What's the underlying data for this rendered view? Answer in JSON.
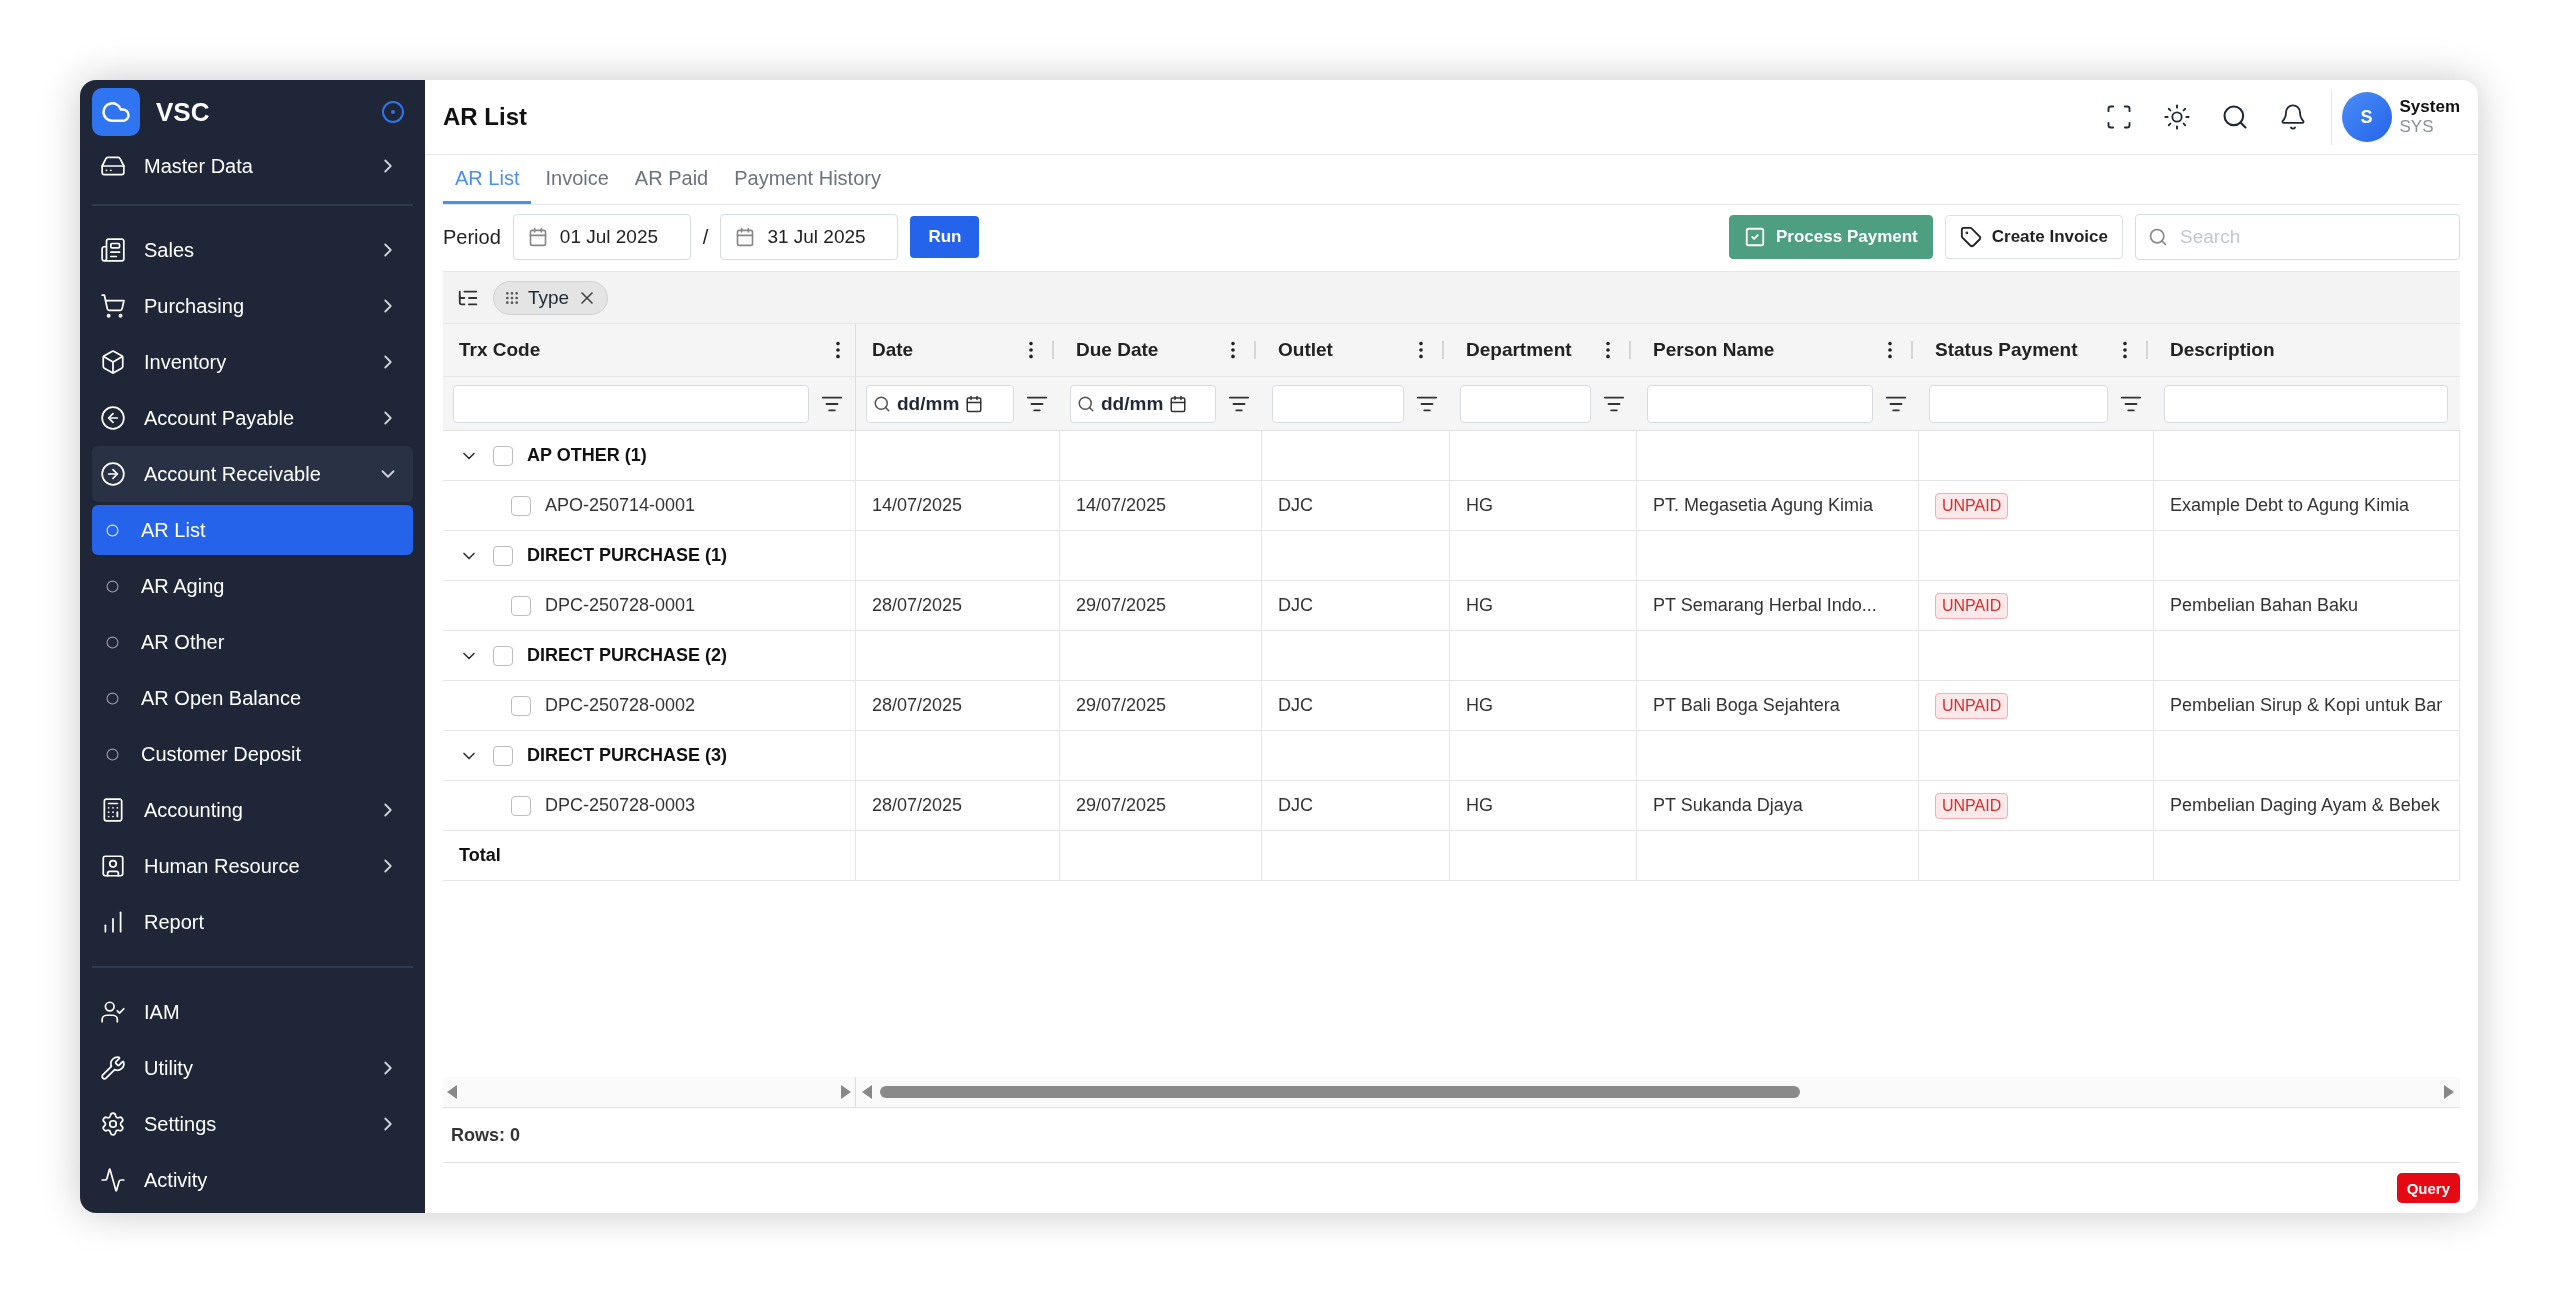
{
  "sidebar": {
    "brand": "VSC",
    "groups": [
      {
        "items": [
          {
            "label": "Master Data",
            "submenu": true,
            "expanded": false
          }
        ]
      },
      {
        "items": [
          {
            "label": "Sales",
            "submenu": true,
            "expanded": false
          },
          {
            "label": "Purchasing",
            "submenu": true,
            "expanded": false
          },
          {
            "label": "Inventory",
            "submenu": true,
            "expanded": false
          },
          {
            "label": "Account Payable",
            "submenu": true,
            "expanded": false
          },
          {
            "label": "Account Receivable",
            "submenu": true,
            "expanded": true,
            "children": [
              {
                "label": "AR List",
                "selected": true
              },
              {
                "label": "AR Aging",
                "selected": false
              },
              {
                "label": "AR Other",
                "selected": false
              },
              {
                "label": "AR Open Balance",
                "selected": false
              },
              {
                "label": "Customer Deposit",
                "selected": false
              }
            ]
          },
          {
            "label": "Accounting",
            "submenu": true,
            "expanded": false
          },
          {
            "label": "Human Resource",
            "submenu": true,
            "expanded": false
          },
          {
            "label": "Report",
            "submenu": false
          }
        ]
      },
      {
        "items": [
          {
            "label": "IAM",
            "submenu": false
          },
          {
            "label": "Utility",
            "submenu": true,
            "expanded": false
          },
          {
            "label": "Settings",
            "submenu": true,
            "expanded": false
          },
          {
            "label": "Activity",
            "submenu": false
          }
        ]
      }
    ]
  },
  "header": {
    "title": "AR List",
    "user": {
      "initial": "S",
      "name": "System",
      "role": "SYS"
    }
  },
  "tabs": [
    {
      "label": "AR List",
      "selected": true
    },
    {
      "label": "Invoice",
      "selected": false
    },
    {
      "label": "AR Paid",
      "selected": false
    },
    {
      "label": "Payment History",
      "selected": false
    }
  ],
  "period": {
    "label": "Period",
    "from": "01 Jul 2025",
    "separator": "/",
    "to": "31 Jul 2025",
    "run": "Run"
  },
  "actions": [
    {
      "label": "Process Payment",
      "kind": "primary"
    },
    {
      "label": "Create Invoice",
      "kind": "outline"
    }
  ],
  "search": {
    "placeholder": "Search"
  },
  "group_by": [
    {
      "label": "Type"
    }
  ],
  "table": {
    "columns": [
      {
        "label": "Trx Code",
        "kind": "text",
        "menu": true
      },
      {
        "label": "Date",
        "kind": "date",
        "filter_value": "dd/mm",
        "menu": true
      },
      {
        "label": "Due Date",
        "kind": "date",
        "filter_value": "dd/mm",
        "menu": true
      },
      {
        "label": "Outlet",
        "kind": "text",
        "menu": true
      },
      {
        "label": "Department",
        "kind": "text",
        "menu": true
      },
      {
        "label": "Person Name",
        "kind": "text",
        "menu": true
      },
      {
        "label": "Status Payment",
        "kind": "status",
        "menu": true
      },
      {
        "label": "Description",
        "kind": "text",
        "menu": false
      }
    ],
    "groups": [
      {
        "label": "AP OTHER (1)",
        "expanded": true,
        "checked": false,
        "rows": [
          {
            "checked": false,
            "cells": [
              "APO-250714-0001",
              "14/07/2025",
              "14/07/2025",
              "DJC",
              "HG",
              "PT. Megasetia Agung Kimia",
              "UNPAID",
              "Example Debt to Agung Kimia"
            ]
          }
        ]
      },
      {
        "label": "DIRECT PURCHASE (1)",
        "expanded": true,
        "checked": false,
        "rows": [
          {
            "checked": false,
            "cells": [
              "DPC-250728-0001",
              "28/07/2025",
              "29/07/2025",
              "DJC",
              "HG",
              "PT Semarang Herbal Indo...",
              "UNPAID",
              "Pembelian Bahan Baku"
            ]
          }
        ]
      },
      {
        "label": "DIRECT PURCHASE (2)",
        "expanded": true,
        "checked": false,
        "rows": [
          {
            "checked": false,
            "cells": [
              "DPC-250728-0002",
              "28/07/2025",
              "29/07/2025",
              "DJC",
              "HG",
              "PT Bali Boga Sejahtera",
              "UNPAID",
              "Pembelian Sirup & Kopi untuk Bar"
            ]
          }
        ]
      },
      {
        "label": "DIRECT PURCHASE (3)",
        "expanded": true,
        "checked": false,
        "rows": [
          {
            "checked": false,
            "cells": [
              "DPC-250728-0003",
              "28/07/2025",
              "29/07/2025",
              "DJC",
              "HG",
              "PT Sukanda Djaya",
              "UNPAID",
              "Pembelian Daging Ayam & Bebek"
            ]
          }
        ]
      }
    ],
    "total_label": "Total"
  },
  "footer": {
    "rows": "Rows: 0",
    "query": "Query"
  }
}
